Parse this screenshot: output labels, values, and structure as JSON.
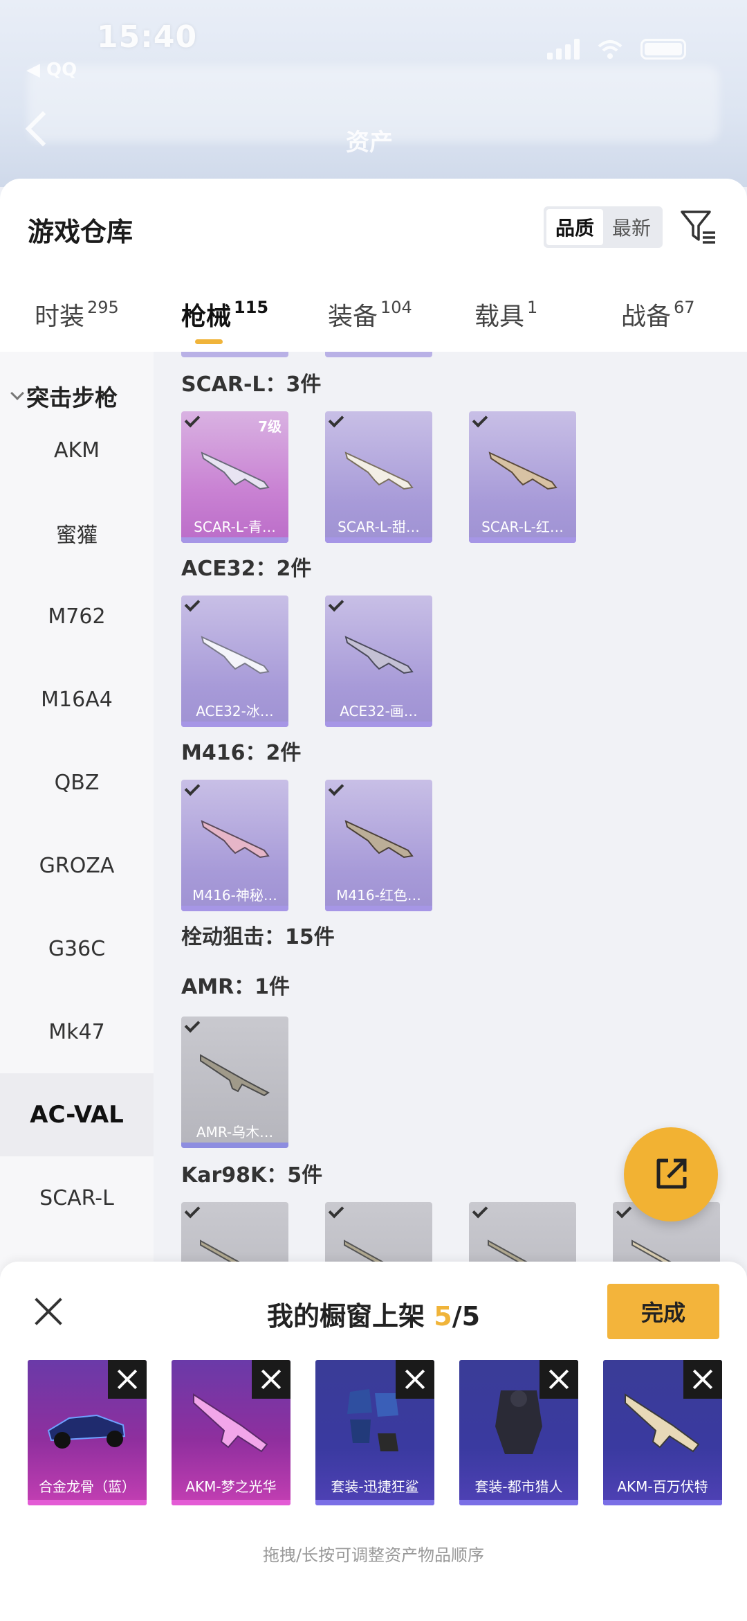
{
  "status": {
    "time": "15:40",
    "back_app": "◀ QQ"
  },
  "bg_header": {
    "title": "资产"
  },
  "warehouse": {
    "title": "游戏仓库",
    "sort_options": [
      "品质",
      "最新"
    ],
    "tabs": [
      {
        "label": "时装",
        "count": "295"
      },
      {
        "label": "枪械",
        "count": "115"
      },
      {
        "label": "装备",
        "count": "104"
      },
      {
        "label": "载具",
        "count": "1"
      },
      {
        "label": "战备",
        "count": "67"
      }
    ]
  },
  "sidebar": {
    "group": "突击步枪",
    "items": [
      "AKM",
      "蜜獾",
      "M762",
      "M16A4",
      "QBZ",
      "GROZA",
      "G36C",
      "Mk47",
      "AC-VAL",
      "SCAR-L"
    ],
    "active": "AC-VAL"
  },
  "sections": [
    {
      "title": "SCAR-L：3件",
      "cards": [
        {
          "label": "SCAR-L-青…",
          "level": "7级",
          "rarity": "pink"
        },
        {
          "label": "SCAR-L-甜…",
          "rarity": "purple"
        },
        {
          "label": "SCAR-L-红…",
          "rarity": "purple"
        }
      ]
    },
    {
      "title": "ACE32：2件",
      "cards": [
        {
          "label": "ACE32-冰…",
          "rarity": "purple"
        },
        {
          "label": "ACE32-画…",
          "rarity": "purple"
        }
      ]
    },
    {
      "title": "M416：2件",
      "cards": [
        {
          "label": "M416-神秘…",
          "rarity": "purple"
        },
        {
          "label": "M416-红色…",
          "rarity": "purple"
        }
      ]
    },
    {
      "title": "栓动狙击：15件"
    },
    {
      "title": "AMR：1件",
      "cards": [
        {
          "label": "AMR-乌木…",
          "rarity": "gray"
        }
      ]
    },
    {
      "title": "Kar98K：5件"
    }
  ],
  "showcase": {
    "title": "我的橱窗上架",
    "count": "5",
    "total": "/5",
    "done_label": "完成",
    "items": [
      {
        "label": "合金龙骨（蓝）",
        "color": "pink"
      },
      {
        "label": "AKM-梦之光华",
        "color": "pink"
      },
      {
        "label": "套装-迅捷狂鲨",
        "color": "blue"
      },
      {
        "label": "套装-都市猎人",
        "color": "blue"
      },
      {
        "label": "AKM-百万伏特",
        "color": "blue"
      }
    ],
    "hint": "拖拽/长按可调整资产物品顺序"
  },
  "colors": {
    "accent": "#f2b233",
    "purple_card": "#a79ad8",
    "pink_card": "#c982d3"
  }
}
